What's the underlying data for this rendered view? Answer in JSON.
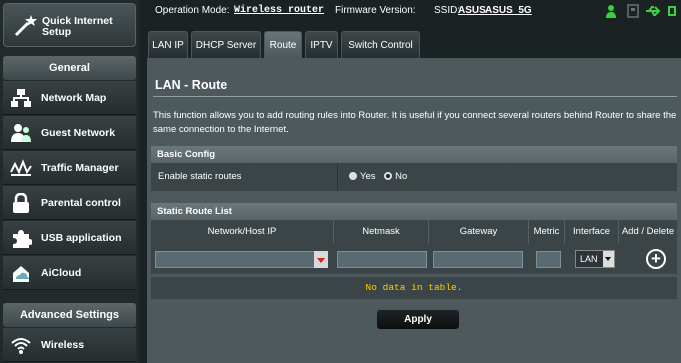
{
  "sidebar": {
    "quick_setup": "Quick Internet Setup",
    "general_head": "General",
    "items": [
      {
        "label": "Network Map",
        "icon": "network-map-icon"
      },
      {
        "label": "Guest Network",
        "icon": "guest-network-icon"
      },
      {
        "label": "Traffic Manager",
        "icon": "traffic-manager-icon"
      },
      {
        "label": "Parental control",
        "icon": "parental-control-icon"
      },
      {
        "label": "USB application",
        "icon": "usb-application-icon"
      },
      {
        "label": "AiCloud",
        "icon": "aicloud-icon"
      }
    ],
    "advanced_head": "Advanced Settings",
    "advanced_items": [
      {
        "label": "Wireless",
        "icon": "wireless-icon"
      }
    ]
  },
  "topbar": {
    "op_mode_label": "Operation Mode:",
    "op_mode_value": "Wireless router",
    "firmware_label": "Firmware Version:",
    "ssid_label": "SSID:",
    "ssid_1": "ASUS",
    "ssid_2": "ASUS_5G"
  },
  "tabs": [
    {
      "label": "LAN IP"
    },
    {
      "label": "DHCP Server"
    },
    {
      "label": "Route"
    },
    {
      "label": "IPTV"
    },
    {
      "label": "Switch Control"
    }
  ],
  "main": {
    "title": "LAN - Route",
    "description": "This function allows you to add routing rules into Router. It is useful if you connect several routers behind Router to share the same connection to the Internet.",
    "basic_config_head": "Basic Config",
    "static_routes_label": "Enable static routes",
    "opt_yes": "Yes",
    "opt_no": "No",
    "static_list_head": "Static Route List",
    "columns": [
      "Network/Host IP",
      "Netmask",
      "Gateway",
      "Metric",
      "Interface",
      "Add / Delete"
    ],
    "interface_value": "LAN",
    "no_data": "No data in table.",
    "apply": "Apply"
  },
  "colors": {
    "panel": "#4d595d",
    "accent_yellow": "#ffcc00",
    "status_green": "#3ad13a"
  }
}
